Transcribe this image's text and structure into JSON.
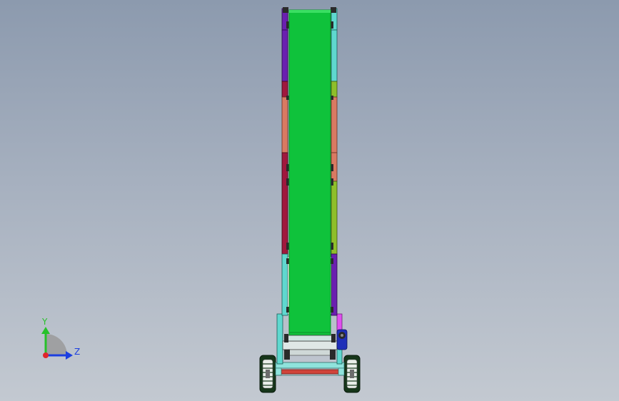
{
  "colors": {
    "background_top": "#8c9aae",
    "background_bottom": "#c3c9d1",
    "belt": "#0fc23b",
    "belt_edge": "#0a8f2a",
    "frame_teal": "#5fd8cf",
    "rail_purple": "#6a1fb0",
    "rail_salmon": "#d97a62",
    "rail_crimson": "#a0173d",
    "rail_olive": "#8fbf2a",
    "support_magenta": "#e04ff0",
    "motor_blue": "#1f2fb8",
    "wheel_tread": "#16361a",
    "wheel_hub": "#e9eee9",
    "axle_red": "#d0433a",
    "axis_x": "#e0262b",
    "axis_y": "#27c12a",
    "axis_z": "#1c3fe0"
  },
  "triad": {
    "y_label": "Y",
    "z_label": "Z"
  }
}
